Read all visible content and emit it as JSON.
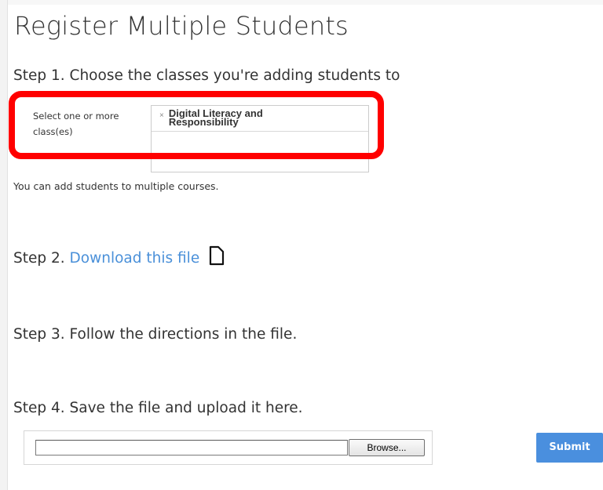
{
  "page": {
    "title": "Register Multiple Students"
  },
  "step1": {
    "text": "Step 1. Choose the classes you're adding students to",
    "select_label": "Select one or more class(es)",
    "selected_classes": [
      {
        "label": "Digital Literacy and Responsibility",
        "remove_glyph": "×"
      }
    ],
    "hint": "You can add students to multiple courses."
  },
  "step2": {
    "prefix": "Step 2. ",
    "link_text": "Download this file",
    "icon": "file-icon"
  },
  "step3": {
    "text": "Step 3. Follow the directions in the file."
  },
  "step4": {
    "text": "Step 4. Save the file and upload it here.",
    "file_path_value": "",
    "browse_label": "Browse...",
    "submit_label": "Submit"
  },
  "colors": {
    "link": "#4a90d9",
    "submit_bg": "#4a8fde",
    "highlight": "#ff0000",
    "text": "#333333"
  }
}
